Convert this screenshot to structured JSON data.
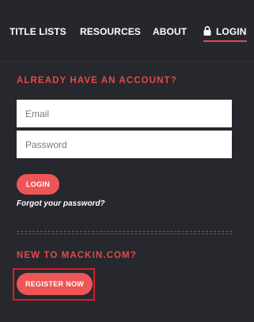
{
  "nav": {
    "items": [
      {
        "label": "TITLE LISTS"
      },
      {
        "label": "RESOURCES"
      },
      {
        "label": "ABOUT"
      },
      {
        "label": "LOGIN",
        "icon": "lock-icon"
      }
    ]
  },
  "login_section": {
    "heading": "ALREADY HAVE AN ACCOUNT?",
    "email_placeholder": "Email",
    "password_placeholder": "Password",
    "login_button": "LOGIN",
    "forgot_link": "Forgot your password?"
  },
  "register_section": {
    "heading": "NEW TO MACKIN.COM?",
    "register_button": "REGISTER NOW"
  },
  "colors": {
    "background": "#26282d",
    "accent": "#e4494c",
    "button": "#ef5556",
    "highlight_box": "#d51f26"
  }
}
